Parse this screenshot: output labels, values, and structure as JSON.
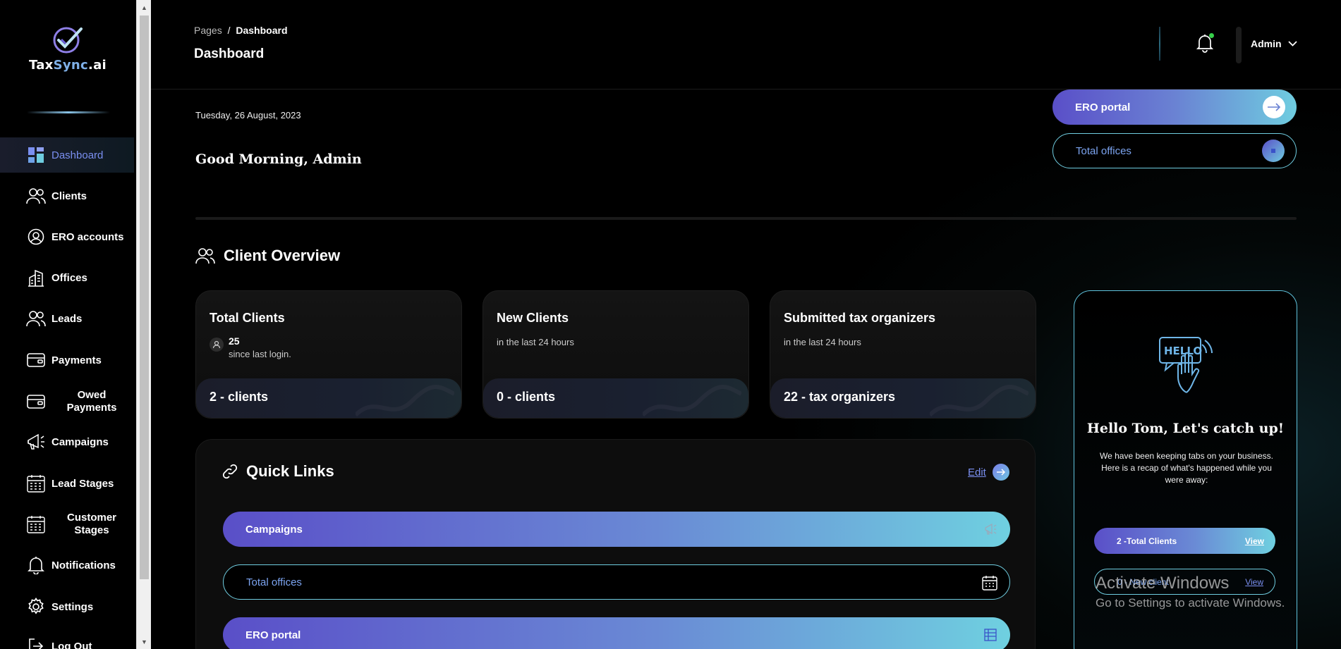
{
  "sidebar": {
    "brand": {
      "part1": "Tax",
      "part2": "Sync",
      "part3": ".ai"
    },
    "items": [
      {
        "label": "Dashboard",
        "icon": "dashboard-icon",
        "active": true
      },
      {
        "label": "Clients",
        "icon": "users-icon"
      },
      {
        "label": "ERO accounts",
        "icon": "user-circle-icon"
      },
      {
        "label": "Offices",
        "icon": "building-icon"
      },
      {
        "label": "Leads",
        "icon": "users-icon"
      },
      {
        "label": "Payments",
        "icon": "wallet-icon"
      },
      {
        "label": "Owed Payments",
        "icon": "wallet-icon"
      },
      {
        "label": "Campaigns",
        "icon": "megaphone-icon"
      },
      {
        "label": "Lead Stages",
        "icon": "calendar-grid-icon"
      },
      {
        "label": "Customer Stages",
        "icon": "calendar-grid-icon"
      },
      {
        "label": "Notifications",
        "icon": "bell-icon"
      },
      {
        "label": "Settings",
        "icon": "gear-icon"
      },
      {
        "label": "Log Out",
        "icon": "logout-icon"
      }
    ]
  },
  "header": {
    "breadcrumb_root": "Pages",
    "breadcrumb_sep": "/",
    "breadcrumb_current": "Dashboard",
    "title": "Dashboard",
    "user": "Admin"
  },
  "hero": {
    "date": "Tuesday, 26 August, 2023",
    "greeting": "Good Morning, Admin",
    "ero_portal": "ERO portal",
    "total_offices": "Total offices"
  },
  "overview": {
    "title": "Client Overview",
    "cards": [
      {
        "title": "Total Clients",
        "count": "25",
        "count_sub": "since last login.",
        "footer": "2 - clients"
      },
      {
        "title": "New Clients",
        "sub": "in the last 24 hours",
        "footer": "0 - clients"
      },
      {
        "title": "Submitted tax organizers",
        "sub": "in the last 24 hours",
        "footer": "22 - tax organizers"
      }
    ]
  },
  "quick_links": {
    "title": "Quick Links",
    "edit": "Edit",
    "items": [
      {
        "label": "Campaigns",
        "icon": "megaphone-icon"
      },
      {
        "label": "Total offices",
        "icon": "calendar-icon"
      },
      {
        "label": "ERO portal",
        "icon": "table-icon"
      }
    ]
  },
  "catchup": {
    "heading": "Hello Tom, Let's catch up!",
    "text": "We have been keeping tabs on your business. Here is a recap of what's happened while you were away:",
    "rows": [
      {
        "label": "2 -Total Clients",
        "action": "View"
      },
      {
        "label": "0 - New client",
        "action": "View"
      }
    ]
  },
  "watermark": {
    "line1": "Activate Windows",
    "line2": "Go to Settings to activate Windows."
  },
  "colors": {
    "accent": "#5a4fc8",
    "accent2": "#6fcde0",
    "link": "#7a8ff0"
  }
}
